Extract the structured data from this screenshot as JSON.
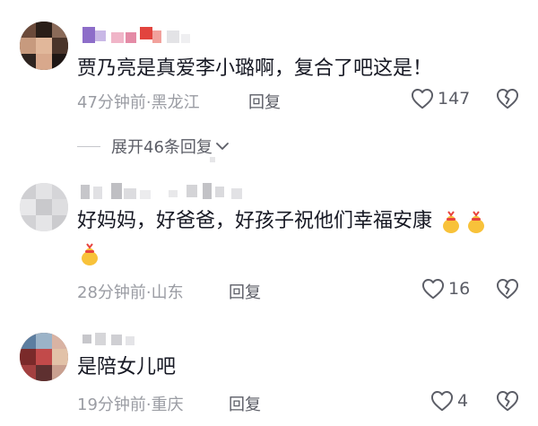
{
  "comments": [
    {
      "text": "贾乃亮是真爱李小璐啊，复合了吧这是！",
      "time": "47分钟前",
      "location": "黑龙江",
      "reply_label": "回复",
      "likes": "147",
      "expand_label": "展开46条回复"
    },
    {
      "text": "好妈妈，好爸爸，好孩子祝他们幸福安康",
      "time": "28分钟前",
      "location": "山东",
      "reply_label": "回复",
      "likes": "16"
    },
    {
      "text": "是陪女儿吧",
      "time": "19分钟前",
      "location": "重庆",
      "reply_label": "回复",
      "likes": "4"
    }
  ],
  "meta_separator": "·",
  "icons": {
    "like": "heart-outline-icon",
    "dislike": "broken-heart-icon",
    "expand": "chevron-down-icon",
    "emoji": "lucky-bag-emoji"
  },
  "colors": {
    "text": "#161823",
    "meta": "#9a9ca3",
    "action": "#5b5d66"
  }
}
